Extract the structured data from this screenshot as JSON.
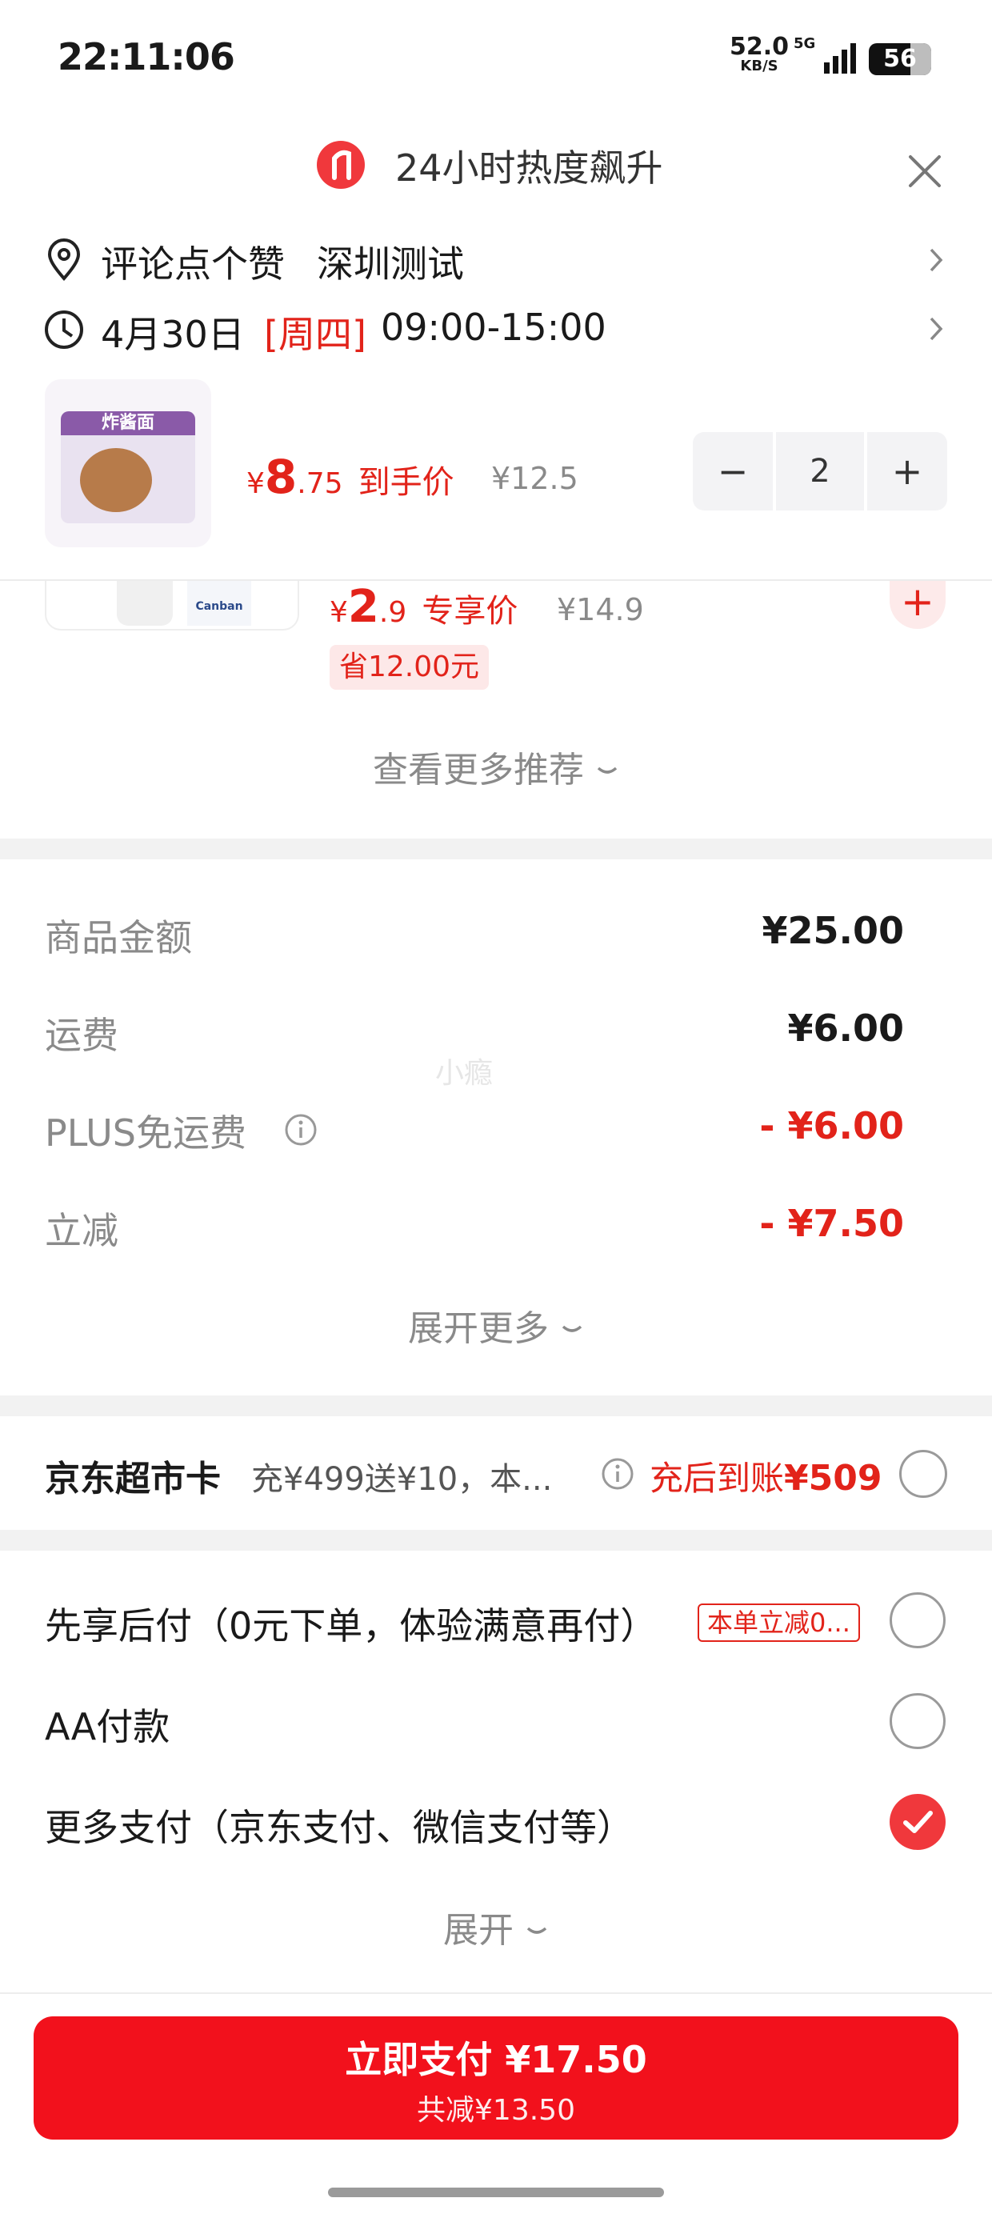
{
  "status_bar": {
    "time": "22:11:06",
    "speed_value": "52.0",
    "speed_unit": "KB/S",
    "network": "5G",
    "battery": "56"
  },
  "toast": {
    "text": "24小时热度飙升"
  },
  "address": {
    "name": "评论点个赞",
    "city": "深圳测试"
  },
  "delivery": {
    "date": "4月30日",
    "weekday": "[周四]",
    "time_range": "09:00-15:00"
  },
  "product_main": {
    "image_label": "炸酱面",
    "currency": "¥",
    "price_int": "8",
    "price_dec": ".75",
    "price_tag": "到手价",
    "original_price": "¥12.5",
    "quantity": "2",
    "minus": "−",
    "plus": "+"
  },
  "product_reco": {
    "image_label": "Canban",
    "currency": "¥",
    "price_int": "2",
    "price_dec": ".9",
    "price_tag": "专享价",
    "original_price": "¥14.9",
    "save": "省12.00元",
    "plus": "+"
  },
  "more_reco": "查看更多推荐",
  "summary": {
    "rows": [
      {
        "label": "商品金额",
        "value": "¥25.00"
      },
      {
        "label": "运费",
        "value": "¥6.00"
      },
      {
        "label": "PLUS免运费",
        "value": "- ¥6.00"
      },
      {
        "label": "立减",
        "value": "- ¥7.50"
      }
    ],
    "watermark": "小瘾",
    "expand": "展开更多"
  },
  "supermarket_card": {
    "title": "京东超市卡",
    "desc": "充¥499送¥10，本...",
    "result_prefix": "充后到账",
    "result_amount": "¥509"
  },
  "payment": {
    "options": [
      {
        "label": "先享后付（0元下单，体验满意再付）",
        "badge": "本单立减0...",
        "selected": false
      },
      {
        "label": "AA付款",
        "selected": false
      },
      {
        "label": "更多支付（京东支付、微信支付等）",
        "selected": true
      }
    ],
    "expand": "展开"
  },
  "pay_button": {
    "label": "立即支付 ¥17.50",
    "sub": "共减¥13.50"
  },
  "colors": {
    "accent": "#e2231a",
    "pay_button": "#f2111c",
    "check": "#f0383c"
  }
}
